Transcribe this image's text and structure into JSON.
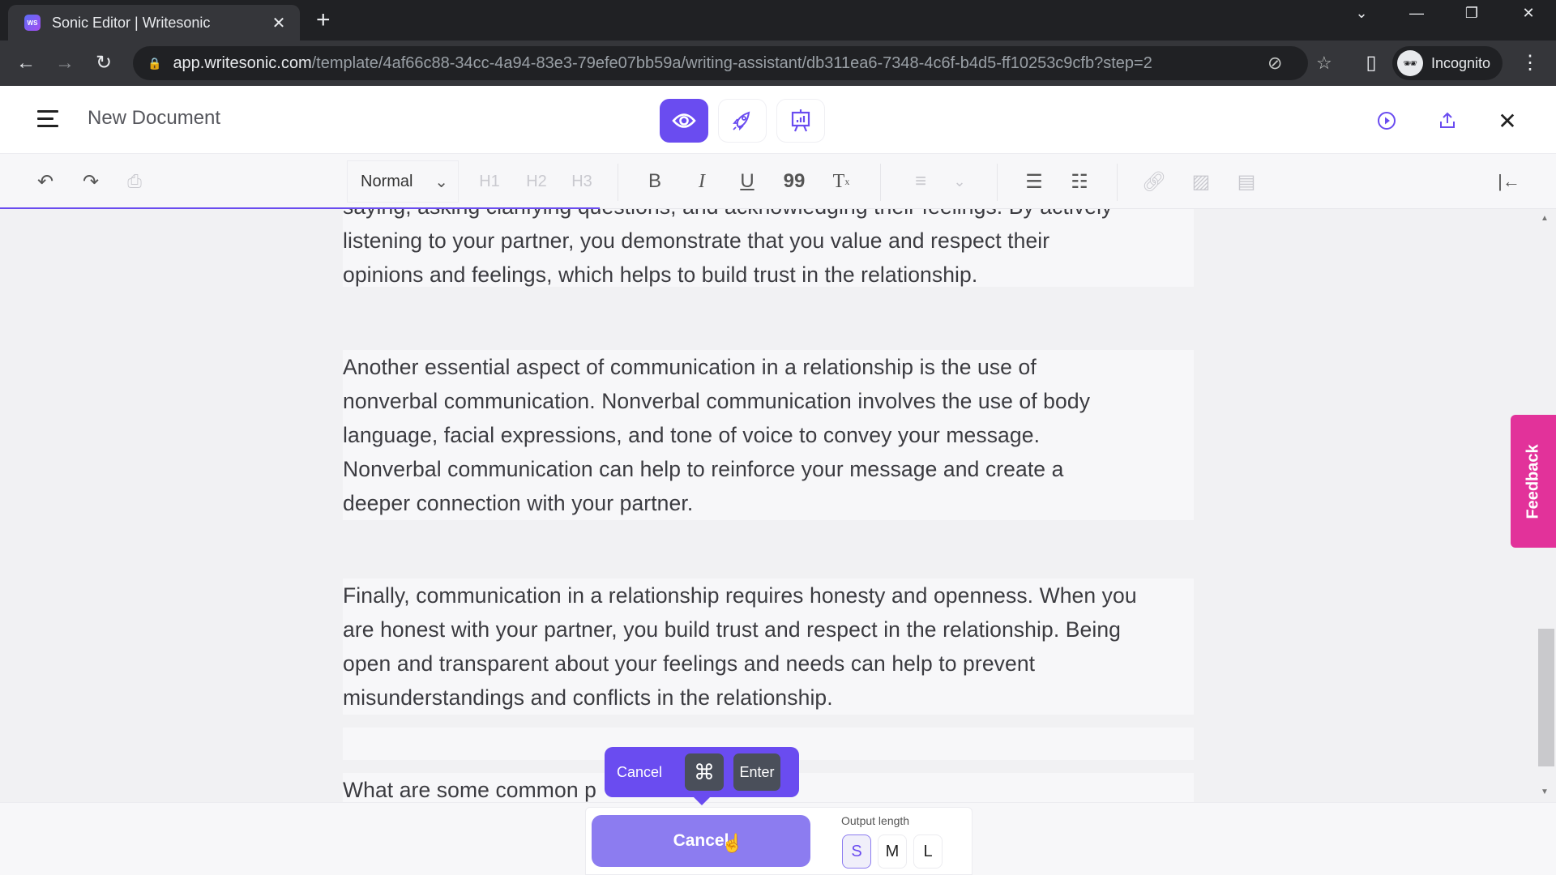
{
  "browser": {
    "tab_title": "Sonic Editor | Writesonic",
    "favicon_text": "WS",
    "url_host": "app.writesonic.com",
    "url_path": "/template/4af66c88-34cc-4a94-83e3-79efe07bb59a/writing-assistant/db311ea6-7348-4c6f-b4d5-ff10253c9cfb?step=2",
    "profile_label": "Incognito",
    "icons": {
      "back": "←",
      "forward": "→",
      "reload": "↻",
      "lock": "🔒",
      "eye_off": "⊘",
      "star": "☆",
      "sidepanel": "▯",
      "kebab": "⋮",
      "new_tab": "+",
      "tab_close": "✕",
      "tab_search": "⌄",
      "minimize": "—",
      "restore": "❐",
      "close": "✕"
    }
  },
  "header": {
    "doc_title": "New Document",
    "close_icon": "✕"
  },
  "toolbar": {
    "undo": "↶",
    "redo": "↷",
    "style_value": "Normal",
    "style_chevron": "⌄",
    "h1": "H1",
    "h2": "H2",
    "h3": "H3",
    "bold": "B",
    "italic": "I",
    "underline": "U",
    "quote": "99",
    "clear_format": "T",
    "align": "≡",
    "align_chevron": "⌄",
    "bullet_list": "☰",
    "numbered_list": "☷",
    "collapse": "|←"
  },
  "document": {
    "paragraphs": [
      {
        "lines": [
          "saying, asking clarifying questions, and acknowledging their feelings. By actively",
          "listening to your partner, you demonstrate that you value and respect their",
          "opinions and feelings, which helps to build trust in the relationship."
        ]
      },
      {
        "lines": [
          "Another essential aspect of communication in a relationship is the use of",
          "nonverbal communication. Nonverbal communication involves the use of body",
          "language, facial expressions, and tone of voice to convey your message.",
          "Nonverbal communication can help to reinforce your message and create a",
          "deeper connection with your partner."
        ]
      },
      {
        "lines": [
          "Finally, communication in a relationship requires honesty and openness. When you",
          "are honest with your partner, you build trust and respect in the relationship. Being",
          "open and transparent about your feelings and needs can help to prevent",
          "misunderstandings and conflicts in the relationship."
        ]
      }
    ],
    "partial_line": "What are some common p"
  },
  "tooltip": {
    "cancel_label": "Cancel",
    "cmd_key": "⌘",
    "enter_key": "Enter"
  },
  "generator": {
    "cancel_button": "Cancel",
    "output_length_label": "Output length",
    "lengths": [
      "S",
      "M",
      "L"
    ],
    "selected_length": "S"
  },
  "feedback_label": "Feedback",
  "colors": {
    "accent": "#6a4cf0",
    "accent_light": "#8c7cf0",
    "feedback": "#e2329a",
    "kbd": "#4a4f5a"
  }
}
